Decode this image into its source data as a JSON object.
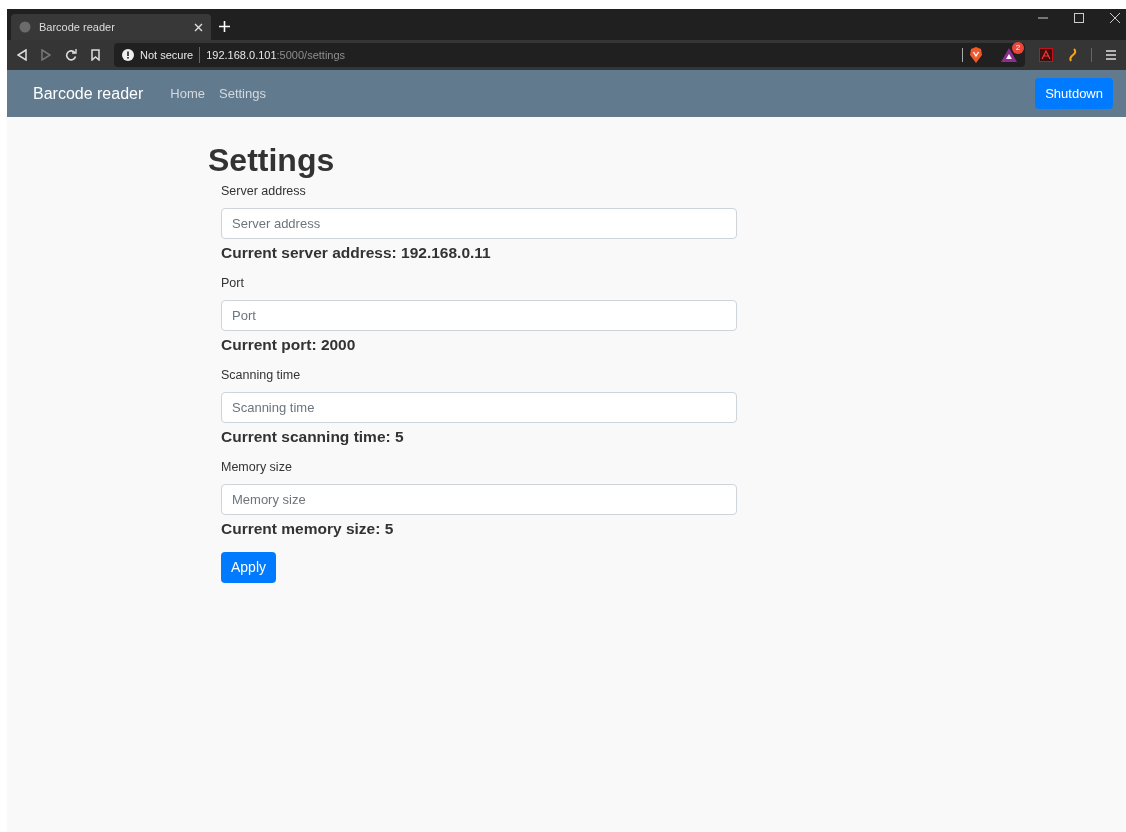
{
  "browser": {
    "tab_title": "Barcode reader",
    "security": "Not secure",
    "url_host": "192.168.0.101",
    "url_path": ":5000/settings",
    "badge_count": "2"
  },
  "navbar": {
    "brand": "Barcode reader",
    "links": [
      "Home",
      "Settings"
    ],
    "button": "Shutdown"
  },
  "page": {
    "title": "Settings",
    "fields": [
      {
        "label": "Server address",
        "placeholder": "Server address",
        "current": "Current server address: 192.168.0.11"
      },
      {
        "label": "Port",
        "placeholder": "Port",
        "current": "Current port: 2000"
      },
      {
        "label": "Scanning time",
        "placeholder": "Scanning time",
        "current": "Current scanning time: 5"
      },
      {
        "label": "Memory size",
        "placeholder": "Memory size",
        "current": "Current memory size: 5"
      }
    ],
    "submit": "Apply"
  }
}
